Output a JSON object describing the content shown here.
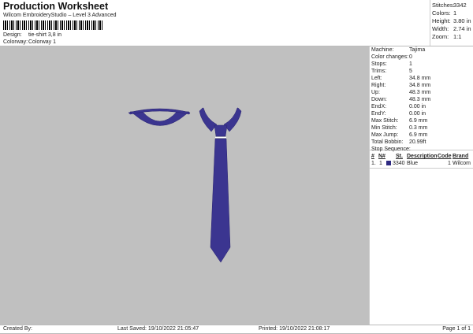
{
  "header": {
    "title": "Production Worksheet",
    "subtitle": "Wilcom EmbroideryStudio – Level 3 Advanced",
    "design_label": "Design:",
    "design_value": "tie-shirt 3,8 in",
    "colorway_label": "Colorway:",
    "colorway_value": "Colorway 1"
  },
  "stats": [
    {
      "label": "Stitches:",
      "value": "3342"
    },
    {
      "label": "Colors:",
      "value": "1"
    },
    {
      "label": "Height:",
      "value": "3.80 in"
    },
    {
      "label": "Width:",
      "value": "2.74 in"
    },
    {
      "label": "Zoom:",
      "value": "1:1"
    }
  ],
  "details": [
    {
      "label": "Machine:",
      "value": "Tajima"
    },
    {
      "label": "Color changes:",
      "value": "0"
    },
    {
      "label": "Stops:",
      "value": "1"
    },
    {
      "label": "Trims:",
      "value": "5"
    },
    {
      "label": "Left:",
      "value": "34.8 mm"
    },
    {
      "label": "Right:",
      "value": "34.8 mm"
    },
    {
      "label": "Up:",
      "value": "48.3 mm"
    },
    {
      "label": "Down:",
      "value": "48.3 mm"
    },
    {
      "label": "EndX:",
      "value": "0.00 in"
    },
    {
      "label": "EndY:",
      "value": "0.00 in"
    },
    {
      "label": "Max Stitch:",
      "value": "6.9 mm"
    },
    {
      "label": "Min Stitch:",
      "value": "0.3 mm"
    },
    {
      "label": "Max Jump:",
      "value": "6.9 mm"
    },
    {
      "label": "Total Bobbin:",
      "value": "20.99ft"
    }
  ],
  "stop_sequence": {
    "title": "Stop Sequence:",
    "headers": [
      "#",
      "N#",
      "St.",
      "Description",
      "Code",
      "Brand"
    ],
    "rows": [
      {
        "num": "1.",
        "n": "1",
        "st": "3340",
        "description": "Blue",
        "code": "1",
        "brand": "Wilcom",
        "color": "#2e2a82"
      }
    ]
  },
  "footer": {
    "created_by": "Created By:",
    "last_saved": "Last Saved: 19/10/2022 21:05:47",
    "printed": "Printed: 19/10/2022 21:08:17",
    "page": "Page 1 of 1"
  },
  "thread_color": "#3b3590"
}
